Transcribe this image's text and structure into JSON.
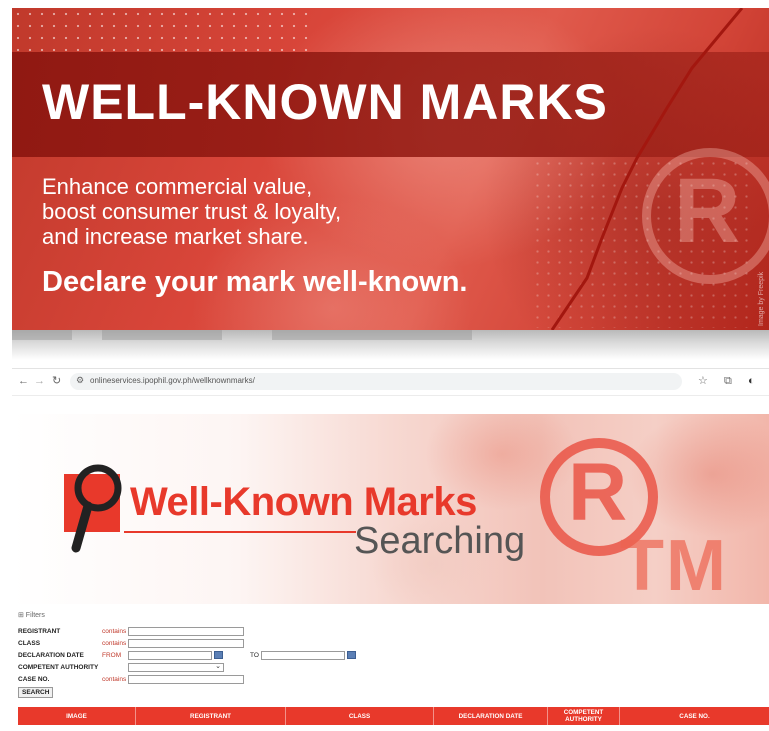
{
  "banner": {
    "title": "WELL-KNOWN MARKS",
    "subtitle_lines": [
      "Enhance commercial value,",
      "boost consumer trust & loyalty,",
      "and increase market share."
    ],
    "call_to_action": "Declare your mark well-known.",
    "image_credit": "Image by Freepik",
    "colors": {
      "primary_red": "#d9463a",
      "dark_red_band": "#8c1610",
      "text": "#ffffff"
    }
  },
  "browser": {
    "url": "onlineservices.ipophil.gov.ph/wellknownmarks/",
    "icons": [
      "back-arrow-icon",
      "forward-arrow-icon",
      "reload-icon",
      "site-settings-icon",
      "star-icon",
      "extensions-icon",
      "profile-icon"
    ]
  },
  "hero": {
    "title_line1": "Well-Known Marks",
    "title_line2": "Searching",
    "registered_symbol": "R",
    "trademark_symbol": "TM",
    "colors": {
      "accent": "#e8392b",
      "subtitle": "#555555"
    }
  },
  "filters": {
    "toggle_label": "⊞ Filters",
    "fields": {
      "registrant": {
        "label": "REGISTRANT",
        "operator": "contains",
        "value": ""
      },
      "class": {
        "label": "CLASS",
        "operator": "contains",
        "value": ""
      },
      "declaration_date": {
        "label": "DECLARATION DATE",
        "from_label": "FROM",
        "to_label": "TO",
        "from_value": "",
        "to_value": ""
      },
      "competent_authority": {
        "label": "COMPETENT AUTHORITY",
        "selected": ""
      },
      "case_no": {
        "label": "CASE NO.",
        "operator": "contains",
        "value": ""
      }
    },
    "search_button": "SEARCH"
  },
  "results_table": {
    "columns": [
      "IMAGE",
      "REGISTRANT",
      "CLASS",
      "DECLARATION DATE",
      "COMPETENT AUTHORITY",
      "CASE NO."
    ],
    "rows": [],
    "colors": {
      "header_bg": "#e8392b",
      "header_text": "#ffffff"
    }
  }
}
